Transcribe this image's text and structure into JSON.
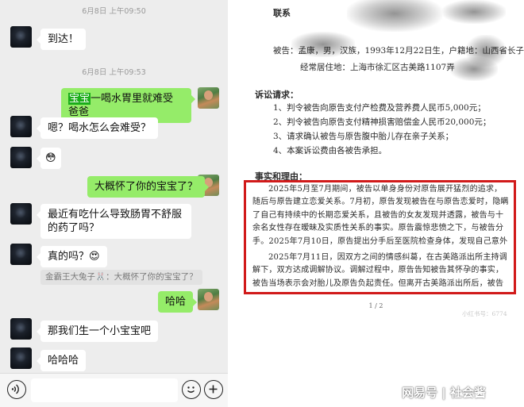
{
  "chat": {
    "timestamps": [
      "6月8日 上午09:50",
      "6月8日 上午09:53"
    ],
    "messages": [
      {
        "side": "in",
        "text": "到达！"
      },
      {
        "side": "out",
        "highlight": "宝宝",
        "text": "一喝水胃里就难受 爸爸"
      },
      {
        "side": "in",
        "text": "嗯？喝水怎么会难受？"
      },
      {
        "side": "in",
        "text": "😳"
      },
      {
        "side": "out",
        "text": "大概怀了你的宝宝了？"
      },
      {
        "side": "in",
        "text": "最近有吃什么导致肠胃不舒服的药了吗？"
      },
      {
        "side": "in",
        "text": "真的吗？😍"
      },
      {
        "side": "out",
        "text": "哈哈"
      },
      {
        "side": "in",
        "text": "那我们生一个小宝宝吧"
      },
      {
        "side": "in",
        "text": "哈哈哈"
      }
    ],
    "quote": "金霸王大兔子🐰：大概怀了你的宝宝了？",
    "input_bar": {
      "voice_icon": "voice-icon",
      "emoji_icon": "emoji-icon",
      "plus_icon": "plus-icon"
    }
  },
  "document": {
    "contact_label": "联系",
    "defendant_line1": "被告：孟康，男，汉族，1993年12月22日生，户籍地：山西省长子县",
    "defendant_line2": "经常居住地：上海市徐汇区古美路1107弄",
    "claims_heading": "诉讼请求：",
    "claims": [
      "1、判令被告向原告支付产检费及营养费人民币5,000元；",
      "2、判令被告向原告支付精神损害赔偿金人民币20,000元；",
      "3、请求确认被告与原告腹中胎儿存在亲子关系；",
      "4、本案诉讼费由各被告承担。"
    ],
    "facts_heading": "事实和理由：",
    "facts_paragraphs": [
      "2025年5月至7月期间，被告以单身身份对原告展开猛烈的追求，随后与原告建立恋爱关系。7月初，原告发现被告在与原告恋爱时，隐瞒了自己有持续中的长期恋爱关系，且被告的女友发现并透露，被告与十余名女性存在暧昧及实质性关系的事实。原告震惊悲愤之下，与被告分手。2025年7月10日，原告提出分手后至医院检查身体，发现自己意外怀孕。",
      "2025年7月11日，因双方之间的情感纠葛，在古美路派出所主持调解下，双方达成调解协议。调解过程中，原告告知被告其怀孕的事实，被告当场表示会对胎儿及原告负起责任。但离开古美路派出所后，被告立即拉"
    ],
    "page_number": "1 / 2",
    "faint_marks": [
      "小红书号：6774"
    ],
    "watermark": "网易号 | 社会酱"
  },
  "colors": {
    "chat_bg": "#ededed",
    "bubble_out": "#95ec69",
    "bubble_in": "#ffffff",
    "highlight": "#1aad19",
    "red_box": "#d11a1a"
  }
}
